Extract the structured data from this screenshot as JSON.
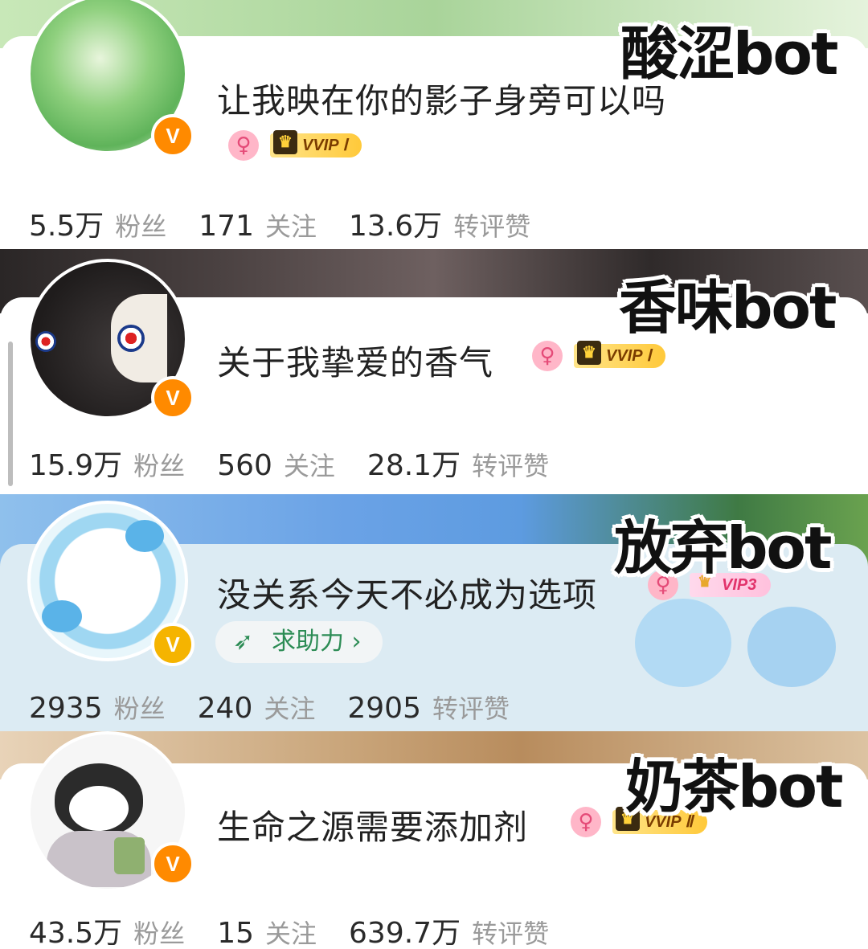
{
  "accounts": [
    {
      "tag": "酸涩bot",
      "name": "让我映在你的影子身旁可以吗",
      "female_symbol": "♀",
      "vip": "VVIP Ⅰ",
      "verified_badge": "V",
      "stats": {
        "followers": "5.5万",
        "followers_label": "粉丝",
        "following": "171",
        "following_label": "关注",
        "interactions": "13.6万",
        "interactions_label": "转评赞"
      },
      "colors": {
        "banner": "#9fd09a",
        "avatar": "#7cc96f"
      }
    },
    {
      "tag": "香味bot",
      "name": "关于我挚爱的香气",
      "female_symbol": "♀",
      "vip": "VVIP Ⅰ",
      "verified_badge": "V",
      "stats": {
        "followers": "15.9万",
        "followers_label": "粉丝",
        "following": "560",
        "following_label": "关注",
        "interactions": "28.1万",
        "interactions_label": "转评赞"
      },
      "colors": {
        "banner": "#3a3535",
        "avatar": "#2d2a2a"
      }
    },
    {
      "tag": "放弃bot",
      "name": "没关系今天不必成为选项",
      "female_symbol": "♀",
      "vip": "VIP3",
      "verified_badge": "V",
      "help_button": "求助力 ›",
      "stats": {
        "followers": "2935",
        "followers_label": "粉丝",
        "following": "240",
        "following_label": "关注",
        "interactions": "2905",
        "interactions_label": "转评赞"
      },
      "colors": {
        "banner": "#6fa6e8",
        "card": "#dcebf3",
        "avatar": "#bfe3f5"
      }
    },
    {
      "tag": "奶茶bot",
      "name": "生命之源需要添加剂",
      "female_symbol": "♀",
      "vip": "VVIP Ⅱ",
      "verified_badge": "V",
      "stats": {
        "followers": "43.5万",
        "followers_label": "粉丝",
        "following": "15",
        "following_label": "关注",
        "interactions": "639.7万",
        "interactions_label": "转评赞"
      },
      "colors": {
        "banner": "#c9a57a",
        "avatar": "#f3f3f3"
      }
    }
  ]
}
